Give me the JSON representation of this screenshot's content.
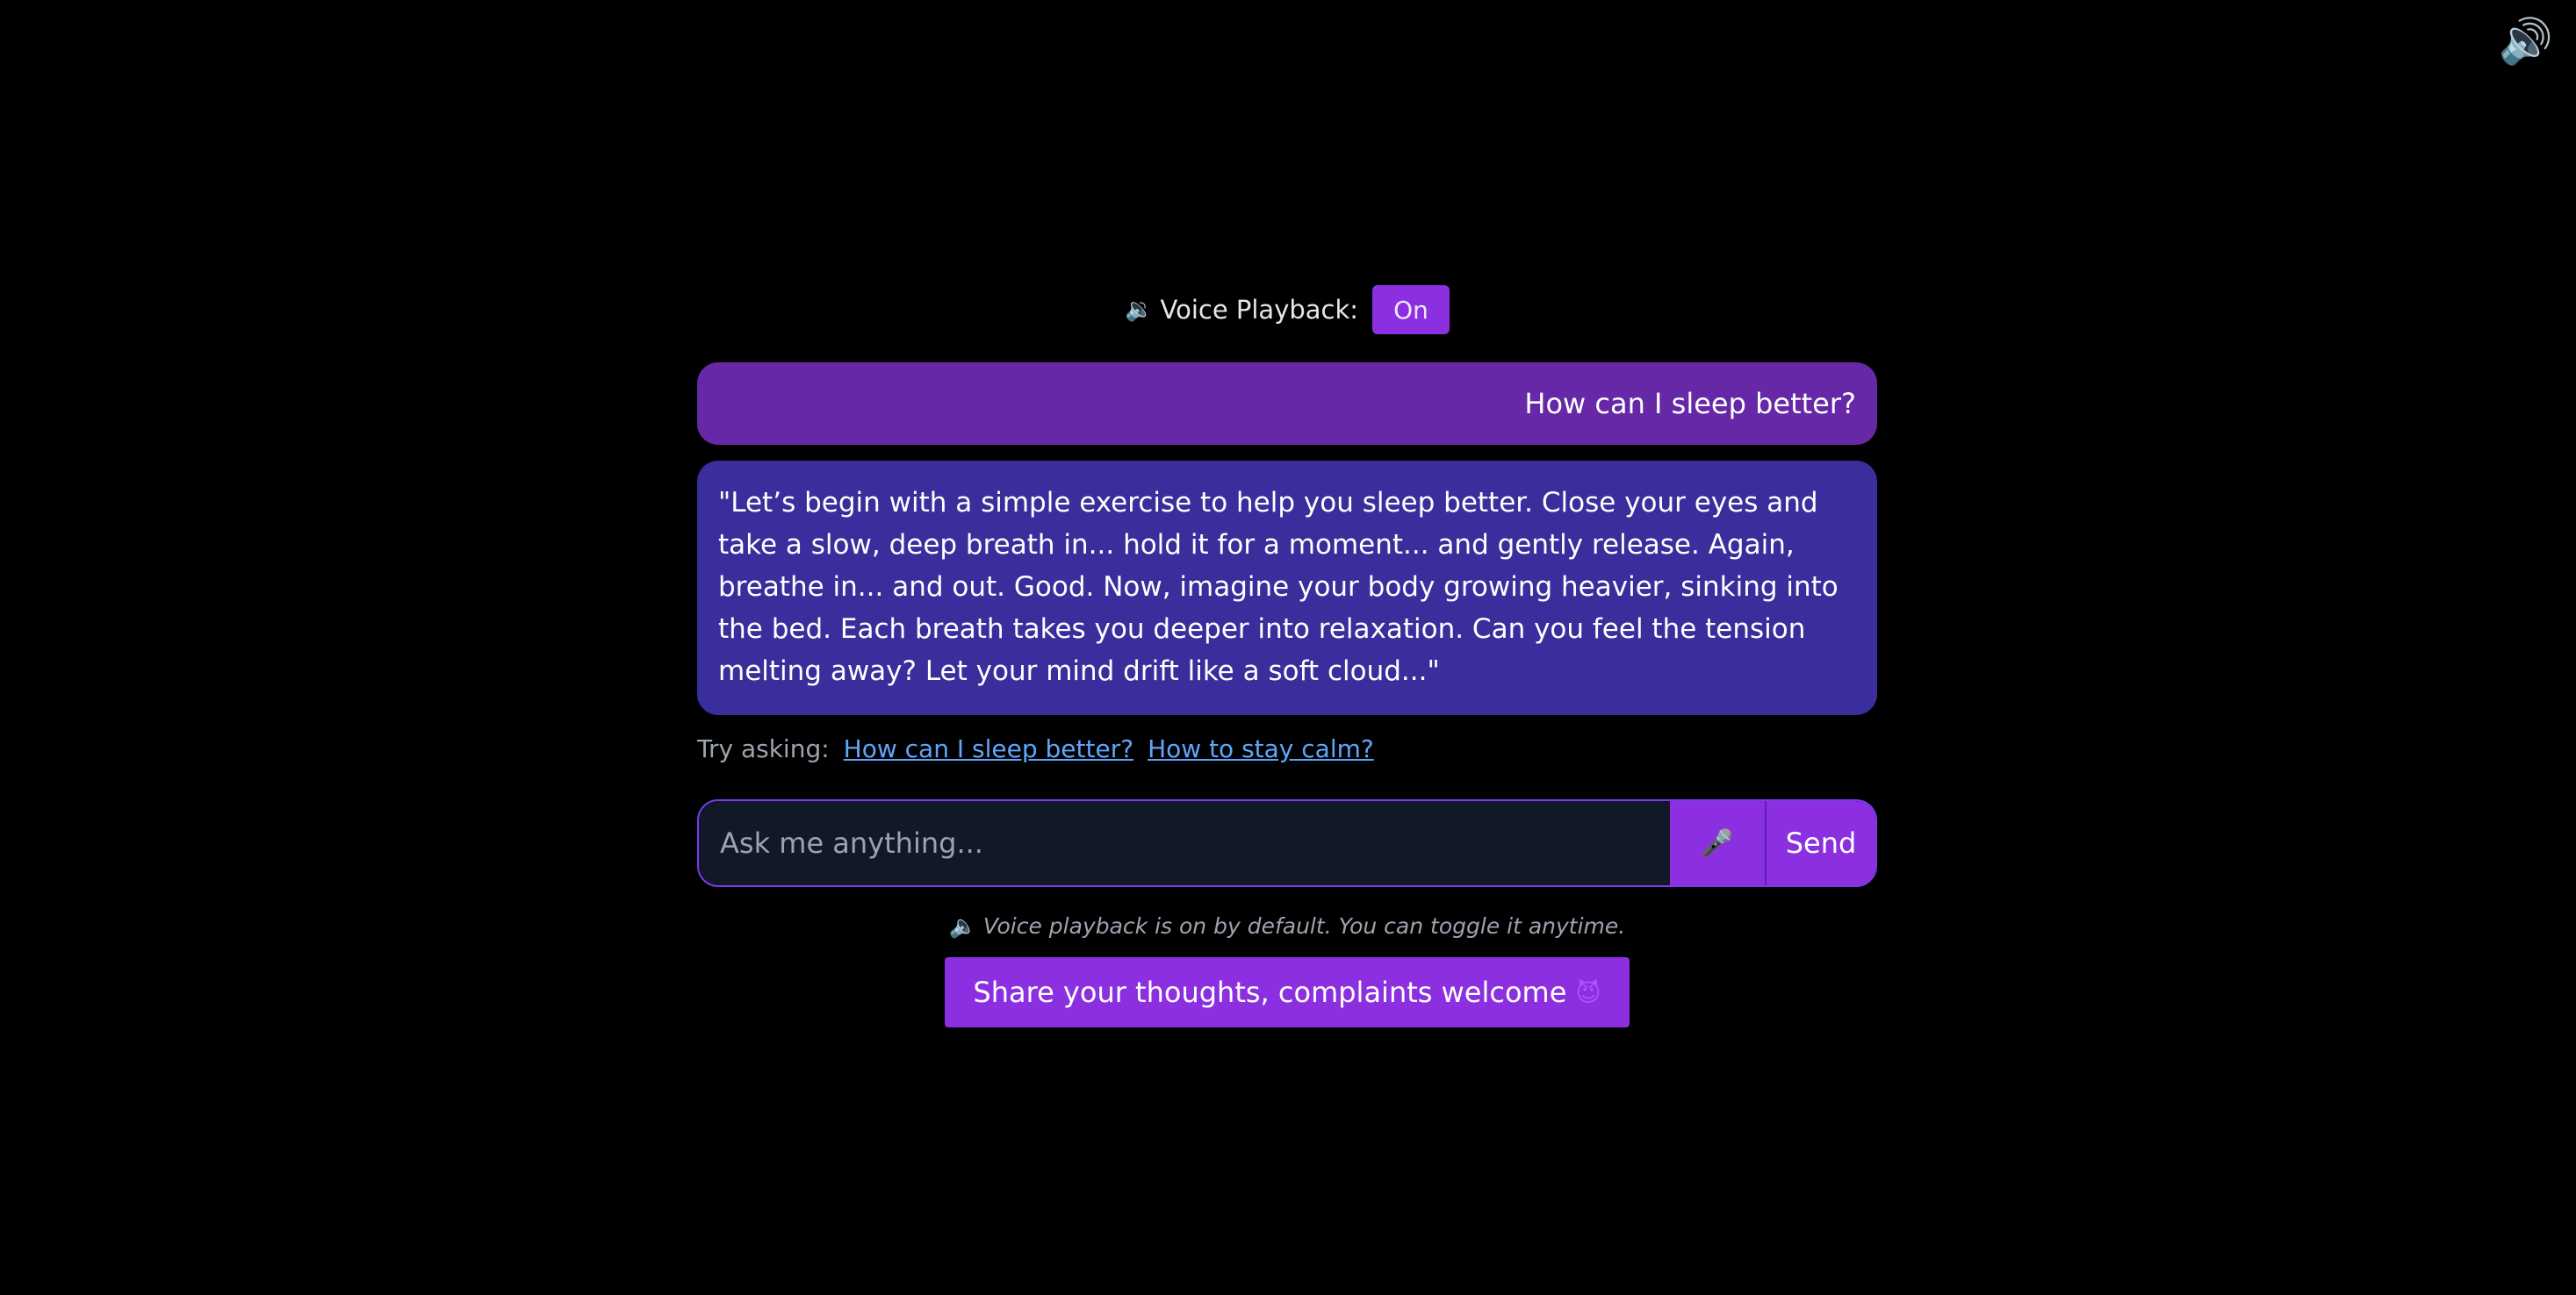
{
  "corner": {
    "icon": "speaker-icon",
    "glyph": "🔊"
  },
  "playback": {
    "icon": "speaker-icon",
    "glyph": "🔉",
    "label": "Voice Playback:",
    "state": "On"
  },
  "chat": {
    "user_message": "How can I sleep better?",
    "bot_message": "\"Let’s begin with a simple exercise to help you sleep better. Close your eyes and take a slow, deep breath in... hold it for a moment... and gently release. Again, breathe in... and out. Good. Now, imagine your body growing heavier, sinking into the bed. Each breath takes you deeper into relaxation. Can you feel the tension melting away? Let your mind drift like a soft cloud...\""
  },
  "suggestions": {
    "label": "Try asking:",
    "items": [
      "How can I sleep better?",
      "How to stay calm?"
    ]
  },
  "input": {
    "placeholder": "Ask me anything...",
    "value": "",
    "mic_icon": "microphone-icon",
    "mic_glyph": "🎤",
    "send_label": "Send"
  },
  "note": {
    "icon": "speaker-icon",
    "glyph": "🔈",
    "text": "Voice playback is on by default. You can toggle it anytime."
  },
  "feedback": {
    "label": "Share your thoughts, complaints welcome",
    "icon": "devil-face-icon",
    "glyph": "😈"
  },
  "colors": {
    "background": "#000000",
    "accent": "#8b2fe0",
    "user_bubble": "#6628a6",
    "bot_bubble": "#3a2e9c",
    "link": "#60a5fa",
    "input_bg": "#111827"
  }
}
